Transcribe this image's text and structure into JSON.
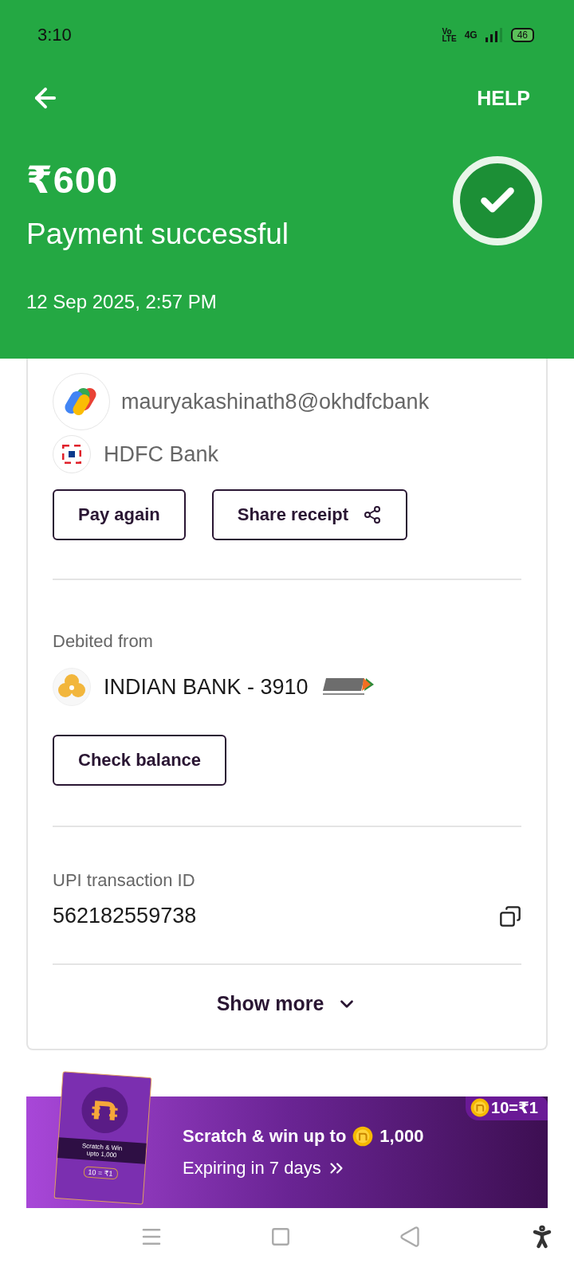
{
  "status_bar": {
    "time": "3:10",
    "volte_top": "Vo",
    "volte_bottom": "LTE",
    "network": "4G",
    "battery": "46"
  },
  "header": {
    "action": "HELP",
    "amount": "₹600",
    "status": "Payment successful",
    "datetime": "12 Sep 2025, 2:57 PM"
  },
  "recipient": {
    "upi_id": "mauryakashinath8@okhdfcbank",
    "bank": "HDFC Bank"
  },
  "actions": [
    {
      "label": "Pay again",
      "kind": "plain"
    },
    {
      "label": "Share receipt",
      "kind": "share"
    }
  ],
  "debit": {
    "label": "Debited from",
    "account": "INDIAN BANK - 3910",
    "button": "Check balance"
  },
  "transaction": {
    "label": "UPI transaction ID",
    "id": "562182559738"
  },
  "show_more": "Show more",
  "promo": {
    "rate": "10=₹1",
    "title_prefix": "Scratch & win up to",
    "title_amount": "1,000",
    "subtitle": "Expiring in 7 days",
    "card_title": "Scratch & Win",
    "card_prefix": "upto",
    "card_amount": "1,000",
    "card_rate": "10 = ₹1"
  }
}
